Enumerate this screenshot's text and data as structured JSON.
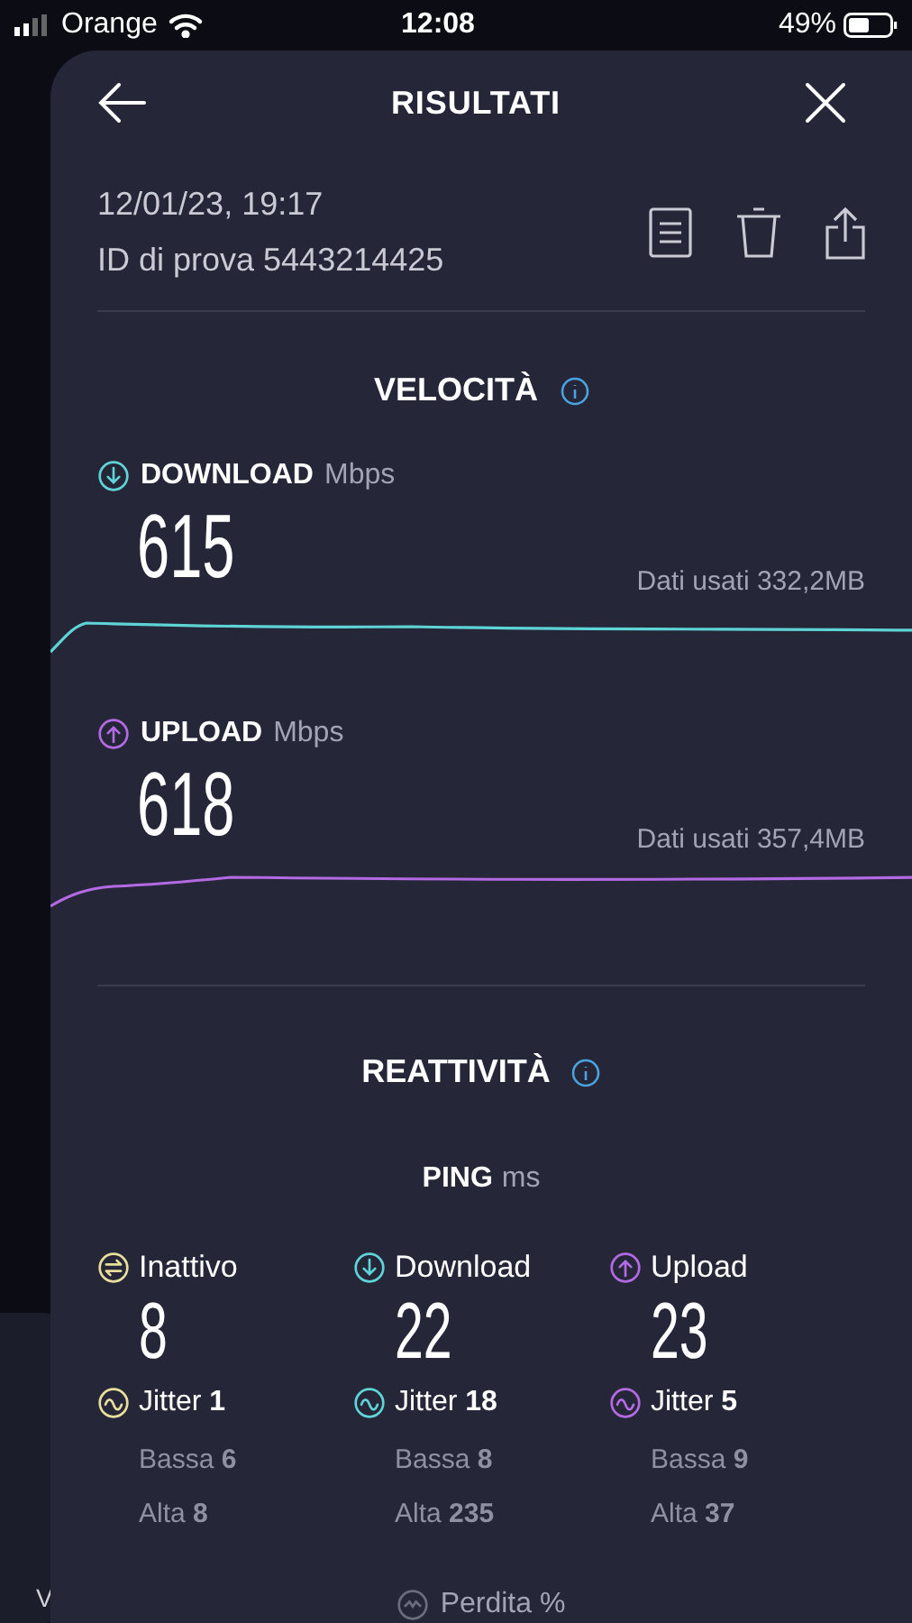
{
  "status_bar": {
    "carrier": "Orange",
    "time": "12:08",
    "battery": "49%"
  },
  "background_card": {
    "text": "V"
  },
  "header": {
    "title": "RISULTATI"
  },
  "test": {
    "date": "12/01/23, 19:17",
    "id": "ID di prova 5443214425"
  },
  "speed": {
    "title": "VELOCITÀ",
    "metrics": [
      {
        "kind": "download",
        "label": "DOWNLOAD",
        "unit": "Mbps",
        "value": "615",
        "data_used": "Dati usati 332,2MB",
        "color": "#5fd4d6"
      },
      {
        "kind": "upload",
        "label": "UPLOAD",
        "unit": "Mbps",
        "value": "618",
        "data_used": "Dati usati 357,4MB",
        "color": "#b36ae2"
      }
    ]
  },
  "responsiveness": {
    "title": "REATTIVITÀ",
    "ping_label": "PING",
    "ping_unit": "ms",
    "columns": [
      {
        "kind": "idle",
        "label": "Inattivo",
        "value": "8",
        "jitter": "Jitter **1**",
        "low": "Bassa **6**",
        "high": "Alta **8**",
        "color": "#e8df9c"
      },
      {
        "kind": "download",
        "label": "Download",
        "value": "22",
        "jitter": "Jitter **18**",
        "low": "Bassa **8**",
        "high": "Alta **235**",
        "color": "#5fd4d6"
      },
      {
        "kind": "upload",
        "label": "Upload",
        "value": "23",
        "jitter": "Jitter **5**",
        "low": "Bassa **9**",
        "high": "Alta **37**",
        "color": "#b36ae2"
      }
    ],
    "loss_label": "Perdita %"
  }
}
